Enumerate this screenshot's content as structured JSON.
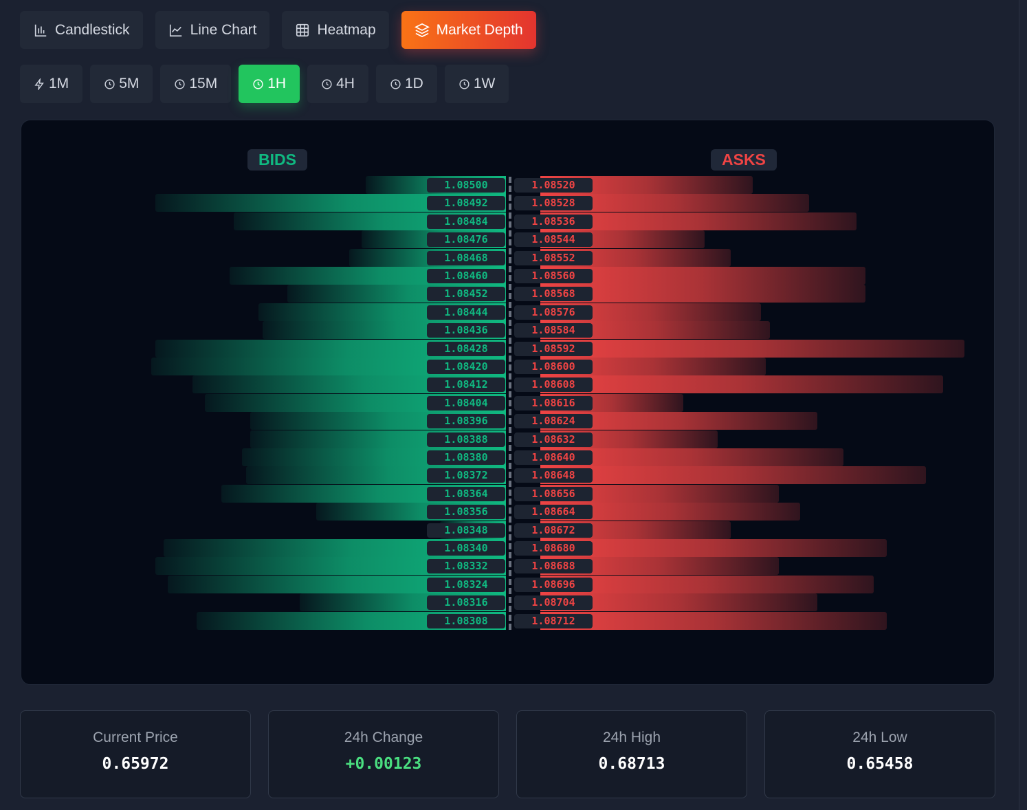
{
  "chart_types": [
    {
      "label": "Candlestick",
      "icon": "bar-chart-icon",
      "active": false
    },
    {
      "label": "Line Chart",
      "icon": "line-chart-icon",
      "active": false
    },
    {
      "label": "Heatmap",
      "icon": "grid-icon",
      "active": false
    },
    {
      "label": "Market Depth",
      "icon": "layers-icon",
      "active": true
    }
  ],
  "timeframes": [
    {
      "label": "1M",
      "icon": "lightning-icon",
      "active": false
    },
    {
      "label": "5M",
      "icon": "clock-icon",
      "active": false
    },
    {
      "label": "15M",
      "icon": "clock-icon",
      "active": false
    },
    {
      "label": "1H",
      "icon": "clock-icon",
      "active": true
    },
    {
      "label": "4H",
      "icon": "clock-icon",
      "active": false
    },
    {
      "label": "1D",
      "icon": "clock-icon",
      "active": false
    },
    {
      "label": "1W",
      "icon": "clock-icon",
      "active": false
    }
  ],
  "depth": {
    "bids_label": "BIDS",
    "asks_label": "ASKS",
    "bid_color": "#10b981",
    "ask_color": "#ef4444",
    "bids": [
      {
        "price": "1.08500",
        "size": 0.34
      },
      {
        "price": "1.08492",
        "size": 0.85
      },
      {
        "price": "1.08484",
        "size": 0.66
      },
      {
        "price": "1.08476",
        "size": 0.35
      },
      {
        "price": "1.08468",
        "size": 0.38
      },
      {
        "price": "1.08460",
        "size": 0.67
      },
      {
        "price": "1.08452",
        "size": 0.53
      },
      {
        "price": "1.08444",
        "size": 0.6
      },
      {
        "price": "1.08436",
        "size": 0.59
      },
      {
        "price": "1.08428",
        "size": 0.85
      },
      {
        "price": "1.08420",
        "size": 0.86
      },
      {
        "price": "1.08412",
        "size": 0.76
      },
      {
        "price": "1.08404",
        "size": 0.73
      },
      {
        "price": "1.08396",
        "size": 0.62
      },
      {
        "price": "1.08388",
        "size": 0.62
      },
      {
        "price": "1.08380",
        "size": 0.64
      },
      {
        "price": "1.08372",
        "size": 0.63
      },
      {
        "price": "1.08364",
        "size": 0.69
      },
      {
        "price": "1.08356",
        "size": 0.46
      },
      {
        "price": "1.08348",
        "size": 0.16
      },
      {
        "price": "1.08340",
        "size": 0.83
      },
      {
        "price": "1.08332",
        "size": 0.85
      },
      {
        "price": "1.08324",
        "size": 0.82
      },
      {
        "price": "1.08316",
        "size": 0.5
      },
      {
        "price": "1.08308",
        "size": 0.75
      }
    ],
    "asks": [
      {
        "price": "1.08520",
        "size": 0.49
      },
      {
        "price": "1.08528",
        "size": 0.62
      },
      {
        "price": "1.08536",
        "size": 0.73
      },
      {
        "price": "1.08544",
        "size": 0.38
      },
      {
        "price": "1.08552",
        "size": 0.44
      },
      {
        "price": "1.08560",
        "size": 0.75
      },
      {
        "price": "1.08568",
        "size": 0.75
      },
      {
        "price": "1.08576",
        "size": 0.51
      },
      {
        "price": "1.08584",
        "size": 0.53
      },
      {
        "price": "1.08592",
        "size": 0.98
      },
      {
        "price": "1.08600",
        "size": 0.52
      },
      {
        "price": "1.08608",
        "size": 0.93
      },
      {
        "price": "1.08616",
        "size": 0.33
      },
      {
        "price": "1.08624",
        "size": 0.64
      },
      {
        "price": "1.08632",
        "size": 0.41
      },
      {
        "price": "1.08640",
        "size": 0.7
      },
      {
        "price": "1.08648",
        "size": 0.89
      },
      {
        "price": "1.08656",
        "size": 0.55
      },
      {
        "price": "1.08664",
        "size": 0.6
      },
      {
        "price": "1.08672",
        "size": 0.44
      },
      {
        "price": "1.08680",
        "size": 0.8
      },
      {
        "price": "1.08688",
        "size": 0.55
      },
      {
        "price": "1.08696",
        "size": 0.77
      },
      {
        "price": "1.08704",
        "size": 0.64
      },
      {
        "price": "1.08712",
        "size": 0.8
      }
    ]
  },
  "stats": [
    {
      "label": "Current Price",
      "value": "0.65972",
      "tone": "neutral"
    },
    {
      "label": "24h Change",
      "value": "+0.00123",
      "tone": "positive"
    },
    {
      "label": "24h High",
      "value": "0.68713",
      "tone": "neutral"
    },
    {
      "label": "24h Low",
      "value": "0.65458",
      "tone": "neutral"
    }
  ]
}
